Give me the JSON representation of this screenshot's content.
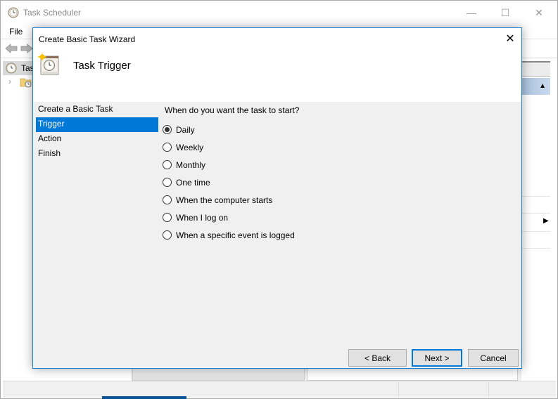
{
  "app": {
    "title": "Task Scheduler",
    "menu": [
      "File"
    ],
    "tree": {
      "root_label": "Tas"
    },
    "window_controls": {
      "minimize": "—",
      "maximize": "☐",
      "close": "✕"
    }
  },
  "dialog": {
    "title": "Create Basic Task Wizard",
    "close_glyph": "✕",
    "heading": "Task Trigger",
    "steps": [
      {
        "label": "Create a Basic Task",
        "active": false
      },
      {
        "label": "Trigger",
        "active": true
      },
      {
        "label": "Action",
        "active": false
      },
      {
        "label": "Finish",
        "active": false
      }
    ],
    "question": "When do you want the task to start?",
    "options": [
      {
        "label": "Daily",
        "checked": true
      },
      {
        "label": "Weekly",
        "checked": false
      },
      {
        "label": "Monthly",
        "checked": false
      },
      {
        "label": "One time",
        "checked": false
      },
      {
        "label": "When the computer starts",
        "checked": false
      },
      {
        "label": "When I log on",
        "checked": false
      },
      {
        "label": "When a specific event is logged",
        "checked": false
      }
    ],
    "buttons": {
      "back": "< Back",
      "next": "Next >",
      "cancel": "Cancel"
    }
  },
  "actions_pane": {
    "collapse_glyph": "▲",
    "submenu_glyph": "▶"
  },
  "colors": {
    "accent": "#0078d7",
    "dialog_border": "#1883d7",
    "dialog_bg": "#f0f0f0"
  }
}
